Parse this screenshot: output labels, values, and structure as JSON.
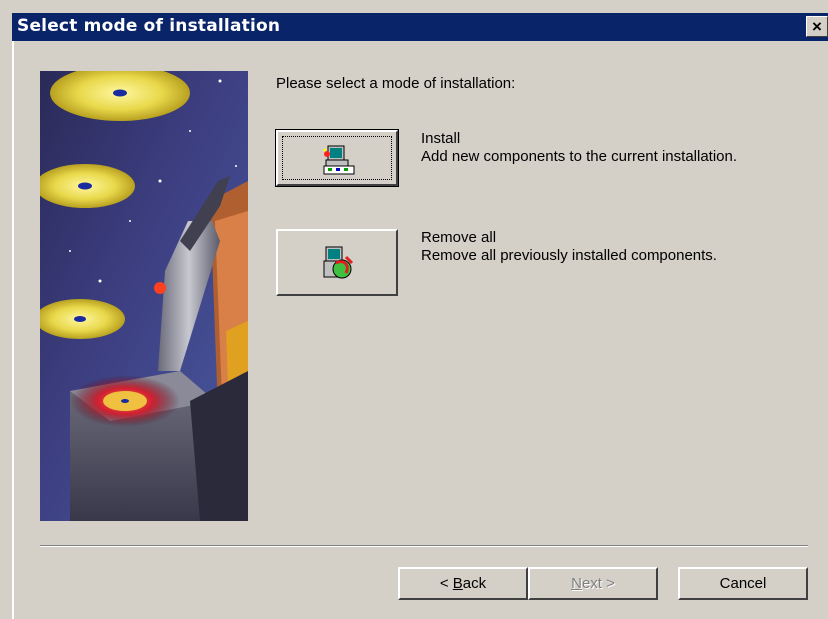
{
  "window": {
    "title": "Select mode of installation",
    "close_label": "×"
  },
  "main": {
    "prompt": "Please select a mode of installation:",
    "modes": [
      {
        "name": "Install",
        "description": "Add new components to the current installation.",
        "icon": "install-computer-icon"
      },
      {
        "name": "Remove all",
        "description": "Remove all previously installed components.",
        "icon": "uninstall-icon"
      }
    ]
  },
  "footer": {
    "back": {
      "pre": "< ",
      "accel": "B",
      "post": "ack"
    },
    "next": {
      "pre": "",
      "accel": "N",
      "post": "ext >",
      "enabled": false
    },
    "cancel_label": "Cancel"
  },
  "colors": {
    "titlebar": "#0a246a",
    "face": "#d4d0c8",
    "disabled_text": "#808080"
  }
}
